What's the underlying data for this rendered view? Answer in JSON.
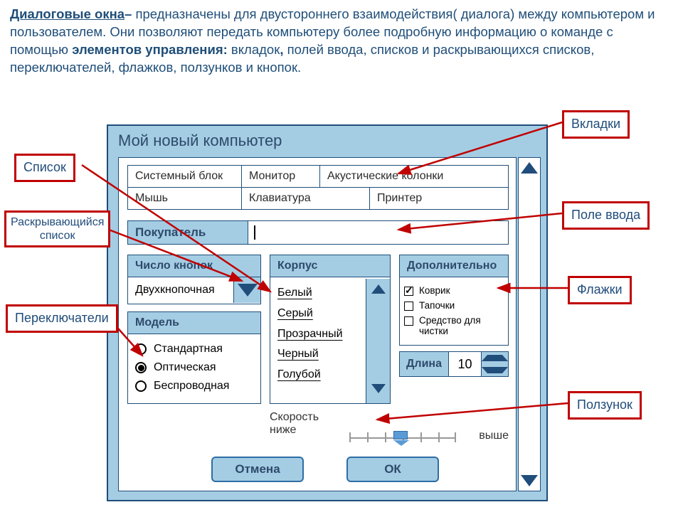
{
  "intro": {
    "term": "Диалоговые окна",
    "dash": "– ",
    "p1a": "предназначены для двустороннего взаимодействия( диалога) между компьютером и пользователем.  Они позволяют передать компьютеру более подробную информацию о команде с помощью ",
    "bold2": "элементов управления: ",
    "p1b": "вкладок",
    "comma1": ", ",
    "p1c": "полей ввода",
    "p1d": ", списков и раскрывающихся списков, переключателей, флажков, ползунков и кнопок."
  },
  "dialog": {
    "title": "Мой новый компьютер",
    "tabs_row1": [
      "Системный блок",
      "Монитор",
      "Акустические колонки"
    ],
    "tabs_row2": [
      "Мышь",
      "Клавиатура",
      "Принтер"
    ],
    "buyer_label": "Покупатель",
    "knopok_head": "Число кнопок",
    "knopok_value": "Двухкнопочная",
    "model_head": "Модель",
    "model_items": [
      "Стандартная",
      "Оптическая",
      "Беспроводная"
    ],
    "model_selected": 1,
    "korpus_head": "Корпус",
    "korpus_items": [
      "Белый",
      "Серый",
      "Прозрачный",
      "Черный",
      "Голубой"
    ],
    "add_head": "Дополнительно",
    "add_items": [
      "Коврик",
      "Тапочки",
      "Средство для чистки"
    ],
    "add_checked": [
      true,
      false,
      false
    ],
    "len_label": "Длина",
    "len_value": "10",
    "slider_label": "Скорость",
    "slider_low": "ниже",
    "slider_high": "выше",
    "btn_cancel": "Отмена",
    "btn_ok": "ОК"
  },
  "callouts": {
    "tabs": "Вкладки",
    "list": "Список",
    "dropdown": "Раскрывающийся\nсписок",
    "input": "Поле ввода",
    "checks": "Флажки",
    "radios": "Переключатели",
    "slider": "Ползунок"
  }
}
